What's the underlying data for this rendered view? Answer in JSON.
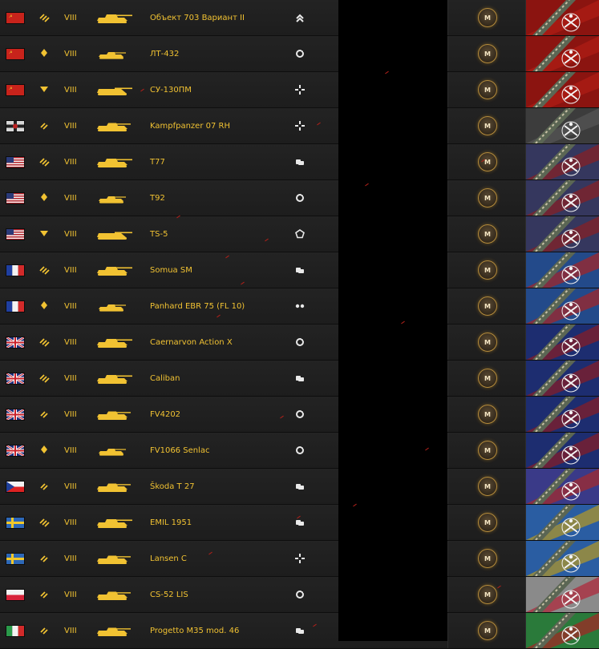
{
  "colors": {
    "accent": "#f1c232",
    "row_bg": "#212121",
    "gap_bg": "#000000"
  },
  "vehicles": [
    {
      "nation": "ussr",
      "flag_icon": "ussr-flag-icon",
      "class_icon": "heavy-tank-icon",
      "tier": "VIII",
      "name": "Объект 703 Вариант II",
      "role_icon": "assault-role-icon",
      "mark": "M"
    },
    {
      "nation": "ussr",
      "flag_icon": "ussr-flag-icon",
      "class_icon": "light-tank-icon",
      "tier": "VIII",
      "name": "ЛТ-432",
      "role_icon": "universal-role-icon",
      "mark": "M"
    },
    {
      "nation": "ussr",
      "flag_icon": "ussr-flag-icon",
      "class_icon": "tank-destroyer-icon",
      "tier": "VIII",
      "name": "СУ-130ПМ",
      "role_icon": "sniper-role-icon",
      "mark": "M"
    },
    {
      "nation": "germany",
      "flag_icon": "germany-flag-icon",
      "class_icon": "medium-tank-icon",
      "tier": "VIII",
      "name": "Kampfpanzer 07 RH",
      "role_icon": "sniper-role-icon",
      "mark": "M"
    },
    {
      "nation": "usa",
      "flag_icon": "usa-flag-icon",
      "class_icon": "heavy-tank-icon",
      "tier": "VIII",
      "name": "T77",
      "role_icon": "support-role-icon",
      "mark": "M"
    },
    {
      "nation": "usa",
      "flag_icon": "usa-flag-icon",
      "class_icon": "light-tank-icon",
      "tier": "VIII",
      "name": "T92",
      "role_icon": "universal-role-icon",
      "mark": "M"
    },
    {
      "nation": "usa",
      "flag_icon": "usa-flag-icon",
      "class_icon": "tank-destroyer-icon",
      "tier": "VIII",
      "name": "TS-5",
      "role_icon": "assault-td-role-icon",
      "mark": "M"
    },
    {
      "nation": "france",
      "flag_icon": "france-flag-icon",
      "class_icon": "heavy-tank-icon",
      "tier": "VIII",
      "name": "Somua SM",
      "role_icon": "support-role-icon",
      "mark": "M"
    },
    {
      "nation": "france",
      "flag_icon": "france-flag-icon",
      "class_icon": "light-tank-icon",
      "tier": "VIII",
      "name": "Panhard EBR 75 (FL 10)",
      "role_icon": "wheeled-role-icon",
      "mark": "M"
    },
    {
      "nation": "uk",
      "flag_icon": "uk-flag-icon",
      "class_icon": "heavy-tank-icon",
      "tier": "VIII",
      "name": "Caernarvon Action X",
      "role_icon": "universal-role-icon",
      "mark": "M"
    },
    {
      "nation": "uk",
      "flag_icon": "uk-flag-icon",
      "class_icon": "heavy-tank-icon",
      "tier": "VIII",
      "name": "Caliban",
      "role_icon": "support-role-icon",
      "mark": "M"
    },
    {
      "nation": "uk",
      "flag_icon": "uk-flag-icon",
      "class_icon": "medium-tank-icon",
      "tier": "VIII",
      "name": "FV4202",
      "role_icon": "universal-role-icon",
      "mark": "M"
    },
    {
      "nation": "uk",
      "flag_icon": "uk-flag-icon",
      "class_icon": "light-tank-icon",
      "tier": "VIII",
      "name": "FV1066 Senlac",
      "role_icon": "universal-role-icon",
      "mark": "M"
    },
    {
      "nation": "czech",
      "flag_icon": "czech-flag-icon",
      "class_icon": "medium-tank-icon",
      "tier": "VIII",
      "name": "Škoda T 27",
      "role_icon": "support-role-icon",
      "mark": "M"
    },
    {
      "nation": "sweden",
      "flag_icon": "sweden-flag-icon",
      "class_icon": "heavy-tank-icon",
      "tier": "VIII",
      "name": "EMIL 1951",
      "role_icon": "support-role-icon",
      "mark": "M"
    },
    {
      "nation": "sweden",
      "flag_icon": "sweden-flag-icon",
      "class_icon": "medium-tank-icon",
      "tier": "VIII",
      "name": "Lansen C",
      "role_icon": "sniper-role-icon",
      "mark": "M"
    },
    {
      "nation": "poland",
      "flag_icon": "poland-flag-icon",
      "class_icon": "medium-tank-icon",
      "tier": "VIII",
      "name": "CS-52 LIS",
      "role_icon": "universal-role-icon",
      "mark": "M"
    },
    {
      "nation": "italy",
      "flag_icon": "italy-flag-icon",
      "class_icon": "medium-tank-icon",
      "tier": "VIII",
      "name": "Progetto M35 mod. 46",
      "role_icon": "support-role-icon",
      "mark": "M"
    }
  ]
}
